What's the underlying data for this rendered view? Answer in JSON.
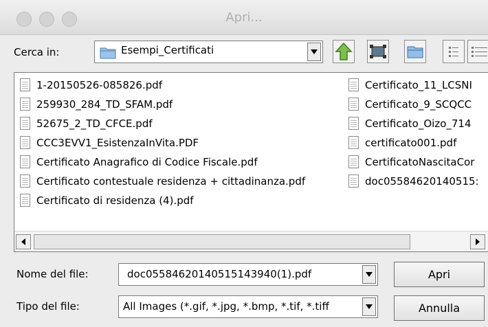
{
  "window": {
    "title": "Apri..."
  },
  "look_in": {
    "label": "Cerca in:",
    "value": "Esempi_Certificati"
  },
  "toolbar": {
    "up_icon": "up-arrow-icon",
    "desktop_icon": "desktop-icon",
    "new_folder_icon": "new-folder-icon",
    "list_view_icon": "list-view-icon",
    "details_view_icon": "details-view-icon"
  },
  "files_col1": [
    "1-20150526-085826.pdf",
    "259930_284_TD_SFAM.pdf",
    "52675_2_TD_CFCE.pdf",
    "CCC3EVV1_EsistenzaInVita.PDF",
    "Certificato Anagrafico di Codice Fiscale.pdf",
    "Certificato contestuale residenza + cittadinanza.pdf",
    "Certificato di residenza (4).pdf"
  ],
  "files_col2": [
    "Certificato_11_LCSNI",
    "Certificato_9_SCQCC",
    "Certificato_Oizo_714",
    "certificato001.pdf",
    "CertificatoNascitaCor",
    "doc05584620140515:"
  ],
  "filename": {
    "label": "Nome del file:",
    "value": "doc05584620140515143940(1).pdf"
  },
  "filetype": {
    "label": "Tipo del file:",
    "value": "All Images (*.gif, *.jpg, *.bmp, *.tif, *.tiff"
  },
  "buttons": {
    "open": "Apri",
    "cancel": "Annulla"
  }
}
